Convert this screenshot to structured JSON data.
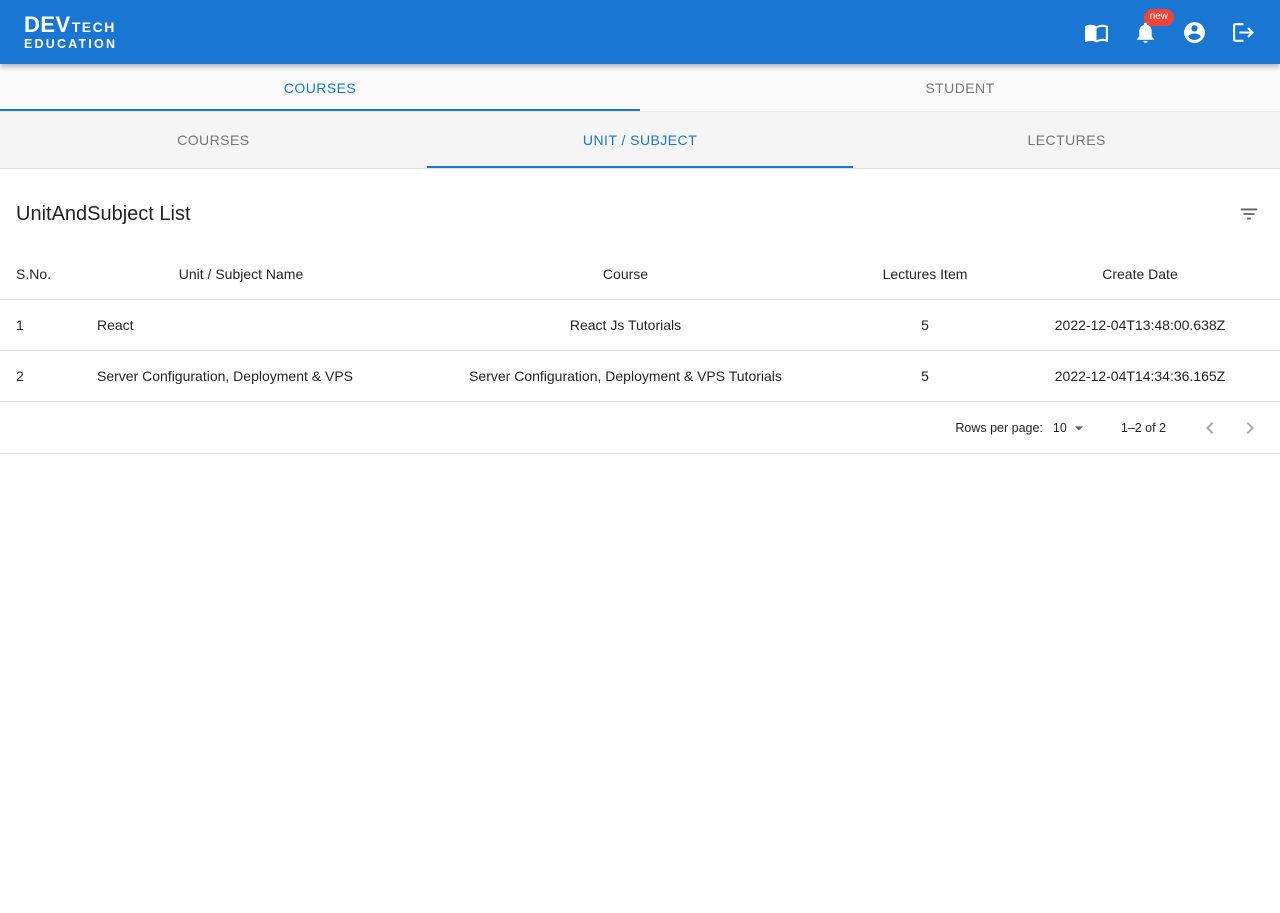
{
  "header": {
    "logo": {
      "dev": "DEV",
      "tech": "TECH",
      "education": "EDUCATION"
    },
    "badge": "new",
    "icons": [
      "menu-book-icon",
      "notifications-bell-icon",
      "account-circle-icon",
      "logout-icon"
    ]
  },
  "tabs_primary": [
    {
      "label": "COURSES",
      "active": true
    },
    {
      "label": "STUDENT",
      "active": false
    }
  ],
  "tabs_secondary": [
    {
      "label": "COURSES",
      "active": false
    },
    {
      "label": "UNIT / SUBJECT",
      "active": true
    },
    {
      "label": "LECTURES",
      "active": false
    }
  ],
  "main": {
    "title": "UnitAndSubject List",
    "table": {
      "columns": [
        "S.No.",
        "Unit / Subject Name",
        "Course",
        "Lectures Item",
        "Create Date"
      ],
      "rows": [
        [
          "1",
          "React",
          "React Js Tutorials",
          "5",
          "2022-12-04T13:48:00.638Z"
        ],
        [
          "2",
          "Server Configuration, Deployment & VPS",
          "Server Configuration, Deployment & VPS Tutorials",
          "5",
          "2022-12-04T14:34:36.165Z"
        ]
      ]
    },
    "pagination": {
      "rows_per_page_label": "Rows per page:",
      "rows_per_page_value": "10",
      "range": "1–2 of 2"
    }
  },
  "colors": {
    "primary": "#1976d2",
    "badge": "#f44336",
    "inactive_tab": "#757575",
    "border": "#e0e0e0"
  }
}
